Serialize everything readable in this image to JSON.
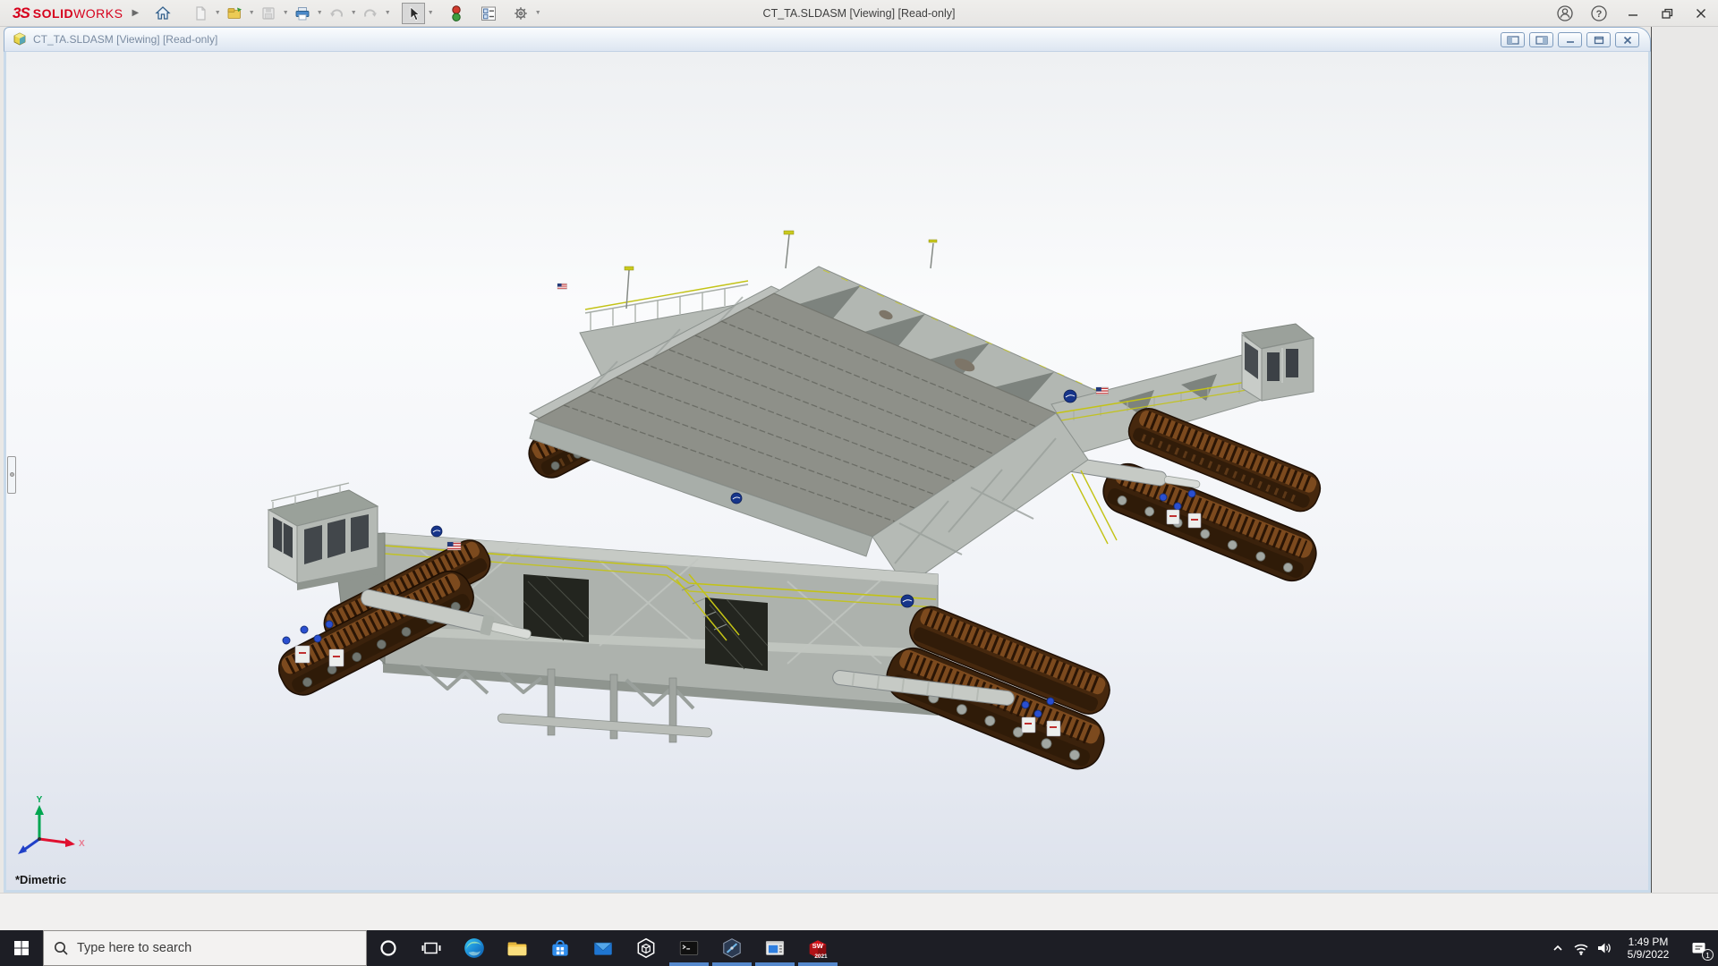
{
  "app": {
    "logo_mark": "3S",
    "logo_solid": "SOLID",
    "logo_works": "WORKS",
    "brand_color": "#d6001c"
  },
  "titlebar": {
    "title": "CT_TA.SLDASM [Viewing] [Read-only]",
    "left_icons": [
      "solidworks-logo",
      "flyout-arrow",
      "home",
      "new-document",
      "open",
      "save",
      "print",
      "undo",
      "redo",
      "select-tool",
      "view-traffic-light",
      "properties",
      "options-gear"
    ],
    "right_icons": [
      "account",
      "help",
      "minimize",
      "restore",
      "close"
    ]
  },
  "document_window": {
    "title": "CT_TA.SLDASM [Viewing] [Read-only]",
    "buttons": [
      "collapse-left-panel",
      "collapse-right-panel",
      "minimize",
      "restore",
      "close"
    ]
  },
  "viewport": {
    "view_label": "*Dimetric",
    "triad": {
      "x_label": "X",
      "y_label": "Y"
    },
    "colors": {
      "background_top": "#f2f4f6",
      "background_bottom": "#dde2ec",
      "body": "#b2b7b2",
      "deck": "#8e9089",
      "tracks": "#3b220c",
      "railings": "#c3c316",
      "nasa_logo": "#17358a"
    }
  },
  "taskbar": {
    "search_placeholder": "Type here to search",
    "icons": [
      "start",
      "search",
      "cortana",
      "task-view",
      "edge",
      "file-explorer",
      "store",
      "mail",
      "3d-viewer",
      "command-prompt",
      "hexagon-viewer",
      "remote-window",
      "solidworks-2021"
    ],
    "running_icons": [
      "command-prompt",
      "hexagon-viewer",
      "remote-window",
      "solidworks-2021"
    ],
    "sw_icon": {
      "label": "SW",
      "year": "2021"
    },
    "tray": {
      "time": "1:49 PM",
      "date": "5/9/2022",
      "notification_badge": "1"
    }
  }
}
